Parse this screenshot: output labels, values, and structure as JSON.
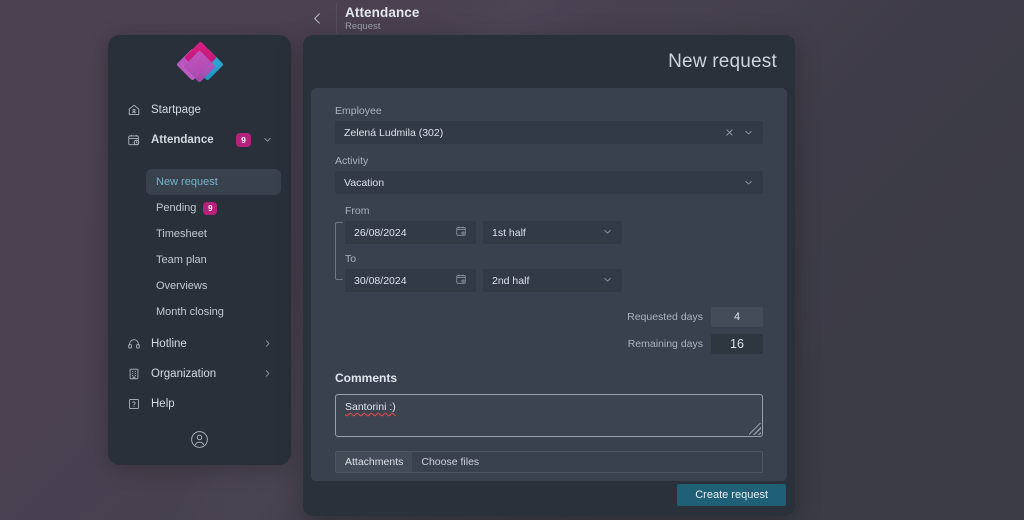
{
  "header": {
    "back_icon": "arrow-left-icon",
    "title": "Attendance",
    "subtitle": "Request"
  },
  "sidebar": {
    "logo_name": "app-logo",
    "items": [
      {
        "label": "Startpage",
        "icon": "home-icon"
      },
      {
        "label": "Attendance",
        "icon": "calendar-clock-icon",
        "badge": "9",
        "chevron": "chevron-down-icon"
      },
      {
        "label": "Hotline",
        "icon": "headset-icon",
        "chevron": "chevron-right-icon"
      },
      {
        "label": "Organization",
        "icon": "building-icon",
        "chevron": "chevron-right-icon"
      },
      {
        "label": "Help",
        "icon": "question-box-icon"
      }
    ],
    "subitems": [
      {
        "label": "New request",
        "active": true
      },
      {
        "label": "Pending",
        "badge": "9"
      },
      {
        "label": "Timesheet"
      },
      {
        "label": "Team plan"
      },
      {
        "label": "Overviews"
      },
      {
        "label": "Month closing"
      }
    ],
    "account_icon": "user-circle-icon"
  },
  "panel": {
    "title": "New request"
  },
  "form": {
    "employee_label": "Employee",
    "employee_value": "Zelená Ludmila (302)",
    "employee_clear_icon": "close-icon",
    "employee_chevron_icon": "chevron-down-icon",
    "activity_label": "Activity",
    "activity_value": "Vacation",
    "activity_chevron_icon": "chevron-down-icon",
    "from_label": "From",
    "from_value": "26/08/2024",
    "from_calendar_icon": "calendar-icon",
    "from_half_value": "1st half",
    "from_half_chevron_icon": "chevron-down-icon",
    "to_label": "To",
    "to_value": "30/08/2024",
    "to_calendar_icon": "calendar-icon",
    "to_half_value": "2nd half",
    "to_half_chevron_icon": "chevron-down-icon",
    "requested_days_label": "Requested days",
    "requested_days_value": "4",
    "remaining_days_label": "Remaining days",
    "remaining_days_value": "16",
    "comments_label": "Comments",
    "comments_value": "Santorini :)",
    "attachments_label": "Attachments",
    "choose_files_label": "Choose files",
    "submit_label": "Create request"
  },
  "colors": {
    "accent_pink": "#b5217c",
    "accent_link": "#74b6cd",
    "primary_button": "#1f6077",
    "sidebar_bg": "#2a303a",
    "panel_bg": "#2b313b",
    "card_bg": "#3a414e"
  }
}
